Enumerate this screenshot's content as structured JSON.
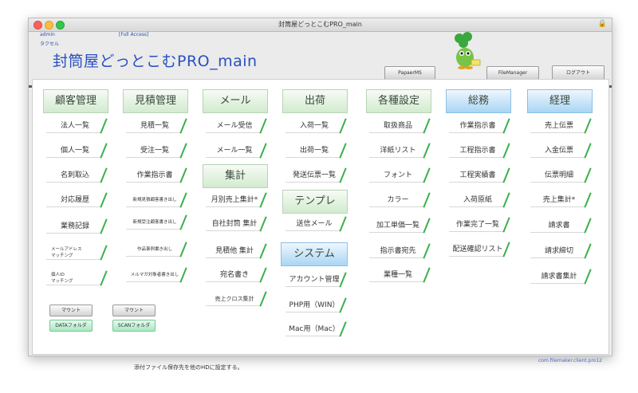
{
  "window": {
    "title": "封筒屋どっとこむPRO_main"
  },
  "header": {
    "user": "admin",
    "access": "[Full Access]",
    "staff": "タクセル",
    "app_title": "封筒屋どっとこむPRO_main",
    "buttons": {
      "papaer_ms": "PapaerMS",
      "file_manager": "FileManager",
      "logout": "ログアウト"
    }
  },
  "columns": {
    "customer": {
      "title": "顧客管理",
      "items": [
        "法人一覧",
        "個人一覧",
        "名刺取込",
        "対応履歴",
        "業務記録",
        "メールアドレス\nマッチング",
        "個人ID\nマッチング"
      ]
    },
    "estimate": {
      "title": "見積管理",
      "items": [
        "見積一覧",
        "受注一覧",
        "作業指示書",
        "新規見積顧客書き出し",
        "新規受注顧客書き出し",
        "作品事例書き出し",
        "メルマガ対象者書き出し"
      ]
    },
    "mail": {
      "title": "メール",
      "items": [
        "メール受信",
        "メール一覧"
      ],
      "sub_title": "集計",
      "sub_items": [
        "月別売上集計*",
        "自社封筒 集計",
        "見積他 集計",
        "宛名書き",
        "売上クロス集計"
      ]
    },
    "shipping": {
      "title": "出荷",
      "items": [
        "入荷一覧",
        "出荷一覧",
        "発送伝票一覧"
      ],
      "template_title": "テンプレ",
      "template_items": [
        "送信メール"
      ],
      "system_title": "システム",
      "system_items": [
        "アカウント管理",
        "PHP用（WIN）",
        "Mac用（Mac）"
      ]
    },
    "settings": {
      "title": "各種設定",
      "items": [
        "取扱商品",
        "洋紙リスト",
        "フォント",
        "カラー",
        "加工単価一覧",
        "指示書宛先",
        "業種一覧"
      ]
    },
    "general": {
      "title": "総務",
      "items": [
        "作業指示書",
        "工程指示書",
        "工程実績書",
        "入荷原紙",
        "作業完了一覧",
        "配送確認リスト"
      ]
    },
    "accounting": {
      "title": "経理",
      "items": [
        "売上伝票",
        "入金伝票",
        "伝票明細",
        "売上集計*",
        "請求書",
        "請求締切",
        "請求書集計"
      ]
    }
  },
  "storage": {
    "mount1": "マウント",
    "mount2": "マウント",
    "data_folder": "DATAフォルダ",
    "scan_folder": "SCANフォルダ",
    "note": "添付ファイル保存先を他のHDに設定する。"
  },
  "version": "com.filemaker.client.pro12",
  "colors": {
    "title_blue": "#2850c0",
    "green_stroke": "#3bb04a",
    "category_green": "#d2ebcf",
    "category_blue": "#a9d5f4"
  }
}
